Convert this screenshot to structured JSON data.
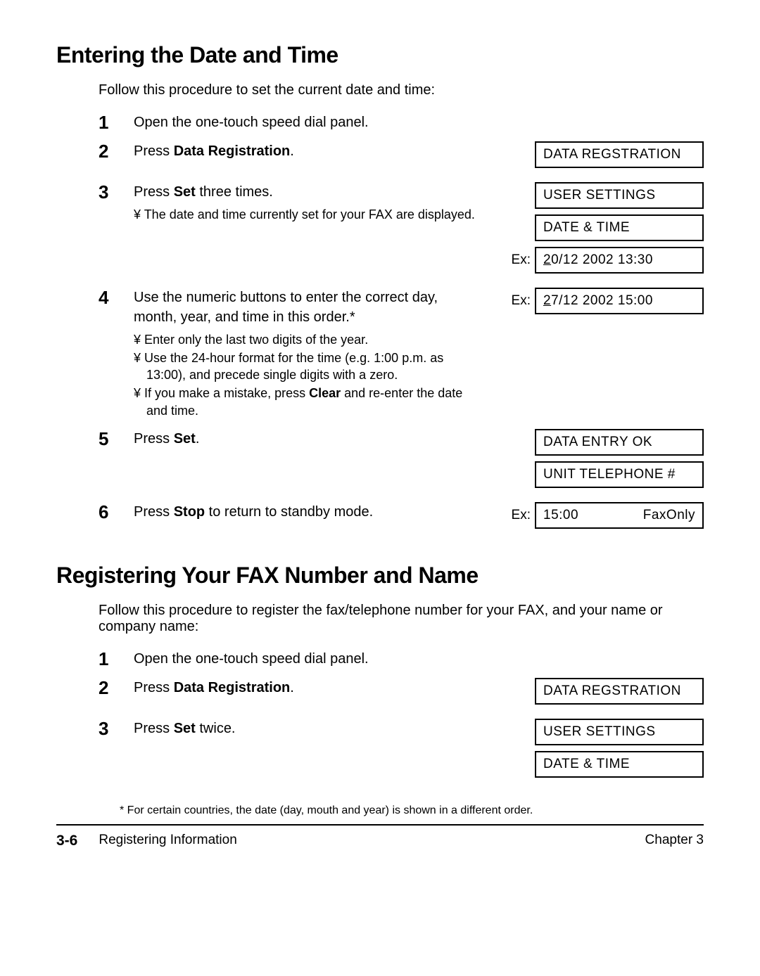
{
  "section1": {
    "heading": "Entering the Date and Time",
    "intro": "Follow this procedure to set the current date and time:",
    "steps": {
      "s1": {
        "num": "1",
        "text": "Open the one-touch speed dial panel."
      },
      "s2": {
        "num": "2",
        "text_pre": "Press ",
        "text_bold": "Data Registration",
        "text_post": ".",
        "display1": "DATA REGSTRATION"
      },
      "s3": {
        "num": "3",
        "text_pre": "Press ",
        "text_bold": "Set",
        "text_post": " three times.",
        "bullet1": "The date and time currently set for your FAX are displayed.",
        "display1": "USER SETTINGS",
        "display2": "DATE & TIME",
        "ex": "Ex:",
        "display3_u": "2",
        "display3_rest": "0/12 2002   13:30"
      },
      "s4": {
        "num": "4",
        "text": "Use the numeric buttons to enter the correct day, month, year, and time in this order.*",
        "bullet1": "Enter only the last two digits of the year.",
        "bullet2": "Use the 24-hour format for the time (e.g. 1:00 p.m. as 13:00), and precede single digits with a zero.",
        "bullet3_pre": "If you make a mistake, press ",
        "bullet3_bold": "Clear",
        "bullet3_post": " and re-enter the date and time.",
        "ex": "Ex:",
        "display_u": "2",
        "display_rest": "7/12 2002   15:00"
      },
      "s5": {
        "num": "5",
        "text_pre": "Press ",
        "text_bold": "Set",
        "text_post": ".",
        "display1": "DATA ENTRY OK",
        "display2": "UNIT TELEPHONE #"
      },
      "s6": {
        "num": "6",
        "text_pre": "Press ",
        "text_bold": "Stop",
        "text_post": " to return to standby mode.",
        "ex": "Ex:",
        "display_left": "15:00",
        "display_right": "FaxOnly"
      }
    }
  },
  "section2": {
    "heading": "Registering Your FAX Number and Name",
    "intro": "Follow this procedure to register the fax/telephone number for your FAX, and your name or company name:",
    "steps": {
      "s1": {
        "num": "1",
        "text": "Open the one-touch speed dial panel."
      },
      "s2": {
        "num": "2",
        "text_pre": "Press ",
        "text_bold": "Data Registration",
        "text_post": ".",
        "display1": "DATA REGSTRATION"
      },
      "s3": {
        "num": "3",
        "text_pre": "Press ",
        "text_bold": "Set",
        "text_post": " twice.",
        "display1": "USER SETTINGS",
        "display2": "DATE & TIME"
      }
    }
  },
  "footnote": "* For certain countries, the date (day, mouth and year) is shown in a different order.",
  "footer": {
    "pagenum": "3-6",
    "title": "Registering Information",
    "chapter": "Chapter 3"
  }
}
